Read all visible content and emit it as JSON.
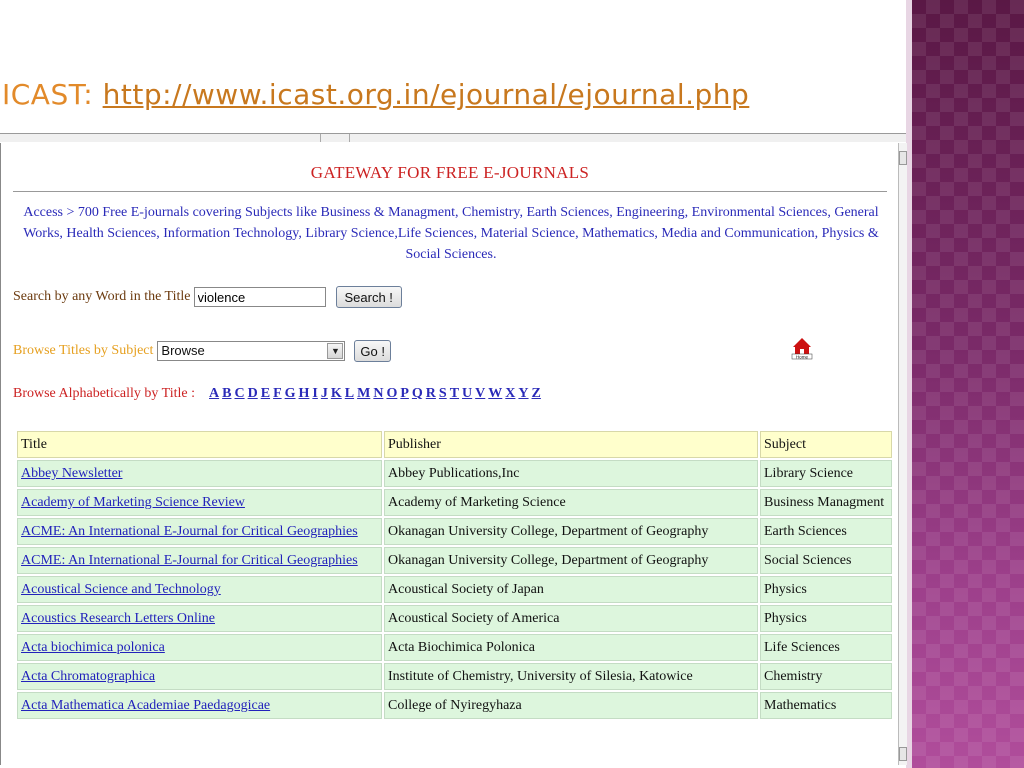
{
  "slide": {
    "label": "ICAST: ",
    "url": "http://www.icast.org.in/ejournal/ejournal.php"
  },
  "page": {
    "heading": "GATEWAY FOR FREE E-JOURNALS",
    "access_text": "Access > 700 Free E-journals covering Subjects like Business & Managment, Chemistry, Earth Sciences, Engineering, Environmental Sciences, General Works, Health Sciences, Information Technology, Library Science,Life Sciences, Material Science, Mathematics, Media and Communication, Physics & Social Sciences."
  },
  "search": {
    "label": "Search by any Word in the Title",
    "value": "violence",
    "button": "Search !"
  },
  "browse": {
    "label": "Browse Titles by Subject",
    "selected": "Browse",
    "button": "Go !"
  },
  "home_icon": "home-icon",
  "alpha": {
    "label": "Browse Alphabetically by Title  :",
    "letters": [
      "A",
      "B",
      "C",
      "D",
      "E",
      "F",
      "G",
      "H",
      "I",
      "J",
      "K",
      "L",
      "M",
      "N",
      "O",
      "P",
      "Q",
      "R",
      "S",
      "T",
      "U",
      "V",
      "W",
      "X",
      "Y",
      "Z"
    ]
  },
  "table": {
    "headers": [
      "Title",
      "Publisher",
      "Subject"
    ],
    "rows": [
      {
        "title": "Abbey Newsletter",
        "publisher": "Abbey Publications,Inc",
        "subject": "Library Science"
      },
      {
        "title": "Academy of Marketing Science Review",
        "publisher": "Academy of Marketing Science",
        "subject": "Business Managment"
      },
      {
        "title": "ACME: An International E-Journal for Critical Geographies",
        "publisher": "Okanagan University College, Department of Geography",
        "subject": "Earth Sciences"
      },
      {
        "title": "ACME: An International E-Journal for Critical Geographies",
        "publisher": "Okanagan University College, Department of Geography",
        "subject": "Social Sciences"
      },
      {
        "title": "Acoustical Science and Technology",
        "publisher": "Acoustical Society of Japan",
        "subject": "Physics"
      },
      {
        "title": "Acoustics Research Letters Online",
        "publisher": "Acoustical Society of America",
        "subject": "Physics"
      },
      {
        "title": "Acta biochimica polonica",
        "publisher": "Acta Biochimica Polonica",
        "subject": "Life Sciences"
      },
      {
        "title": "Acta Chromatographica",
        "publisher": "Institute of Chemistry, University of Silesia, Katowice",
        "subject": "Chemistry"
      },
      {
        "title": "Acta Mathematica Academiae Paedagogicae",
        "publisher": "College of Nyiregyhaza",
        "subject": "Mathematics"
      }
    ]
  },
  "colors": {
    "accent_title": "#e28a2a",
    "gateway_red": "#cc2222",
    "link_blue": "#2222bb",
    "row_green": "#ddf6dd",
    "header_yellow": "#ffffcc",
    "deco_purple": "#7a2a68"
  }
}
